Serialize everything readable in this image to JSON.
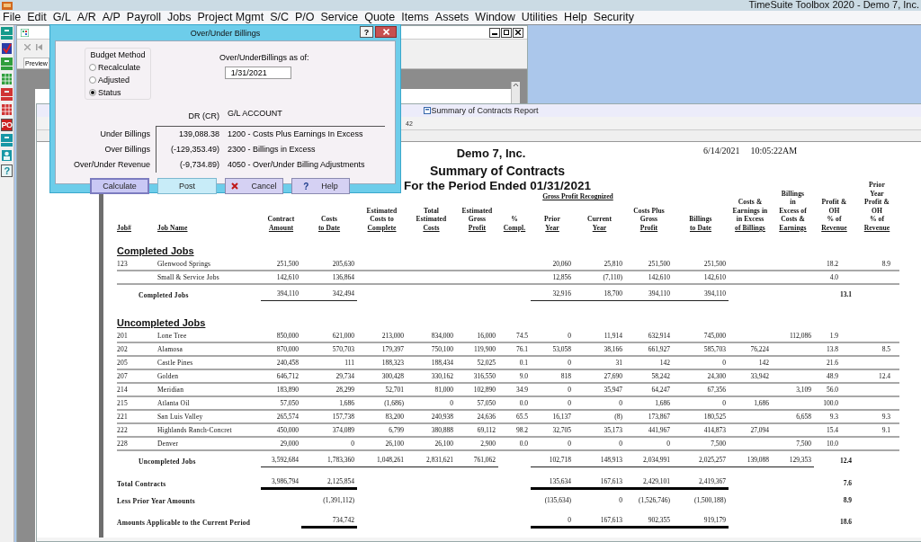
{
  "app": {
    "title": "TimeSuite Toolbox 2020 - Demo 7, Inc."
  },
  "menu": [
    "File",
    "Edit",
    "G/L",
    "A/R",
    "A/P",
    "Payroll",
    "Jobs",
    "Project Mgmt",
    "S/C",
    "P/O",
    "Service",
    "Quote",
    "Items",
    "Assets",
    "Window",
    "Utilities",
    "Help",
    "Security"
  ],
  "left_toolbar": [
    {
      "kind": "monitor",
      "color": "#169a8c"
    },
    {
      "kind": "check",
      "color": "#2a3ea8"
    },
    {
      "kind": "monitor",
      "color": "#2f9e3c"
    },
    {
      "kind": "grid",
      "color": "#2f9e3c"
    },
    {
      "kind": "monitor",
      "color": "#d03434"
    },
    {
      "kind": "grid",
      "color": "#d03434"
    },
    {
      "kind": "text",
      "label": "PO",
      "color": "#cc1f1f"
    },
    {
      "kind": "monitor",
      "color": "#1797a6"
    },
    {
      "kind": "person",
      "color": "#1797a6"
    },
    {
      "kind": "text",
      "label": "?",
      "color": "#1a8a9c"
    }
  ],
  "preview_window": {
    "tab": "Preview",
    "toolbar": [
      {
        "kind": "close",
        "disabled": true
      },
      {
        "kind": "first",
        "disabled": true
      }
    ]
  },
  "report_window": {
    "title": "Summary of Contracts Report",
    "page_field": "42",
    "report": {
      "company": "Demo 7, Inc.",
      "title": "Summary of Contracts",
      "period": "For the Period Ended 01/31/2021",
      "date": "6/14/2021",
      "time": "10:05:22AM",
      "group_header": "Gross Profit Recognized",
      "columns": [
        {
          "lines": [
            "Job#"
          ]
        },
        {
          "lines": [
            "Job Name"
          ]
        },
        {
          "lines": [
            "Contract",
            "Amount"
          ]
        },
        {
          "lines": [
            "Costs",
            "to Date"
          ]
        },
        {
          "lines": [
            "Estimated",
            "Costs to",
            "Complete"
          ]
        },
        {
          "lines": [
            "Total",
            "Estimated",
            "Costs"
          ]
        },
        {
          "lines": [
            "Estimated",
            "Gross",
            "Profit"
          ]
        },
        {
          "lines": [
            "%",
            "Compl."
          ]
        },
        {
          "lines": [
            "Prior",
            "Year"
          ]
        },
        {
          "lines": [
            "Current",
            "Year"
          ]
        },
        {
          "lines": [
            "Costs Plus",
            "Gross",
            "Profit"
          ]
        },
        {
          "lines": [
            "Billings",
            "to Date"
          ]
        },
        {
          "lines": [
            "Costs &",
            "Earnings in",
            "in Excess",
            "of Billings"
          ]
        },
        {
          "lines": [
            "Billings",
            "in",
            "Excess of",
            "Costs &",
            "Earnings"
          ]
        },
        {
          "lines": [
            "Profit &",
            "OH",
            "% of",
            "Revenue"
          ]
        },
        {
          "lines": [
            "Prior",
            "Year",
            "Profit &",
            "OH",
            "% of",
            "Revenue"
          ]
        }
      ],
      "sections": [
        {
          "heading": "Completed Jobs",
          "rows": [
            {
              "job": "123",
              "name": "Glenwood Springs",
              "cells": [
                "251,500",
                "205,630",
                null,
                null,
                null,
                null,
                "20,060",
                "25,810",
                "251,500",
                "251,500",
                null,
                null,
                "18.2",
                "8.9"
              ]
            },
            {
              "name": "Small & Service Jobs",
              "cells": [
                "142,610",
                "136,864",
                null,
                null,
                null,
                null,
                "12,856",
                "(7,110)",
                "142,610",
                "142,610",
                null,
                null,
                "4.0",
                null
              ]
            }
          ],
          "total": {
            "label": "Completed Jobs",
            "cells": [
              "394,110",
              "342,494",
              null,
              null,
              null,
              null,
              "32,916",
              "18,700",
              "394,110",
              "394,110",
              null,
              null,
              "13.1",
              null
            ]
          }
        },
        {
          "heading": "Uncompleted Jobs",
          "rows": [
            {
              "job": "201",
              "name": "Lone Tree",
              "cells": [
                "850,000",
                "621,000",
                "213,000",
                "834,000",
                "16,000",
                "74.5",
                "0",
                "11,914",
                "632,914",
                "745,000",
                null,
                "112,086",
                "1.9",
                null
              ]
            },
            {
              "job": "202",
              "name": "Alamosa",
              "cells": [
                "870,000",
                "570,703",
                "179,397",
                "750,100",
                "119,900",
                "76.1",
                "53,058",
                "38,166",
                "661,927",
                "585,703",
                "76,224",
                null,
                "13.8",
                "8.5"
              ]
            },
            {
              "job": "205",
              "name": "Castle Pines",
              "cells": [
                "240,458",
                "111",
                "188,323",
                "188,434",
                "52,025",
                "0.1",
                "0",
                "31",
                "142",
                "0",
                "142",
                null,
                "21.6",
                null
              ]
            },
            {
              "job": "207",
              "name": "Golden",
              "cells": [
                "646,712",
                "29,734",
                "300,428",
                "330,162",
                "316,550",
                "9.0",
                "818",
                "27,690",
                "58,242",
                "24,300",
                "33,942",
                null,
                "48.9",
                "12.4"
              ]
            },
            {
              "job": "214",
              "name": "Meridian",
              "cells": [
                "183,890",
                "28,299",
                "52,701",
                "81,000",
                "102,890",
                "34.9",
                "0",
                "35,947",
                "64,247",
                "67,356",
                null,
                "3,109",
                "56.0",
                null
              ]
            },
            {
              "job": "215",
              "name": "Atlanta Oil",
              "cells": [
                "57,050",
                "1,686",
                "(1,686)",
                "0",
                "57,050",
                "0.0",
                "0",
                "0",
                "1,686",
                "0",
                "1,686",
                null,
                "100.0",
                null
              ]
            },
            {
              "job": "221",
              "name": "San Luis Valley",
              "cells": [
                "265,574",
                "157,738",
                "83,200",
                "240,938",
                "24,636",
                "65.5",
                "16,137",
                "(8)",
                "173,867",
                "180,525",
                null,
                "6,658",
                "9.3",
                "9.3"
              ]
            },
            {
              "job": "222",
              "name": "Highlands Ranch-Concret",
              "cells": [
                "450,000",
                "374,089",
                "6,799",
                "380,888",
                "69,112",
                "98.2",
                "32,705",
                "35,173",
                "441,967",
                "414,873",
                "27,094",
                null,
                "15.4",
                "9.1"
              ]
            },
            {
              "job": "228",
              "name": "Denver",
              "cells": [
                "29,000",
                "0",
                "26,100",
                "26,100",
                "2,900",
                "0.0",
                "0",
                "0",
                "0",
                "7,500",
                null,
                "7,500",
                "10.0",
                null
              ]
            }
          ],
          "total": {
            "label": "Uncompleted Jobs",
            "cells": [
              "3,592,684",
              "1,783,360",
              "1,048,261",
              "2,831,621",
              "761,062",
              null,
              "102,718",
              "148,913",
              "2,034,991",
              "2,025,257",
              "139,088",
              "129,353",
              "12.4",
              null
            ]
          }
        }
      ],
      "summary": [
        {
          "label": "Total Contracts",
          "cells": [
            "3,986,794",
            "2,125,854",
            null,
            null,
            null,
            null,
            "135,634",
            "167,613",
            "2,429,101",
            "2,419,367",
            null,
            null,
            "7.6",
            null
          ]
        },
        {
          "label": "Less Prior Year Amounts",
          "cells": [
            null,
            "(1,391,112)",
            null,
            null,
            null,
            null,
            "(135,634)",
            "0",
            "(1,526,746)",
            "(1,500,188)",
            null,
            null,
            "8.9",
            null
          ]
        },
        {
          "label": "Amounts Applicable to the Current Period",
          "cells": [
            null,
            "734,742",
            null,
            null,
            null,
            null,
            "0",
            "167,613",
            "902,355",
            "919,179",
            null,
            null,
            "18.6",
            null
          ]
        }
      ]
    }
  },
  "dialog": {
    "title": "Over/Under Billings",
    "help": "?",
    "budget_method": {
      "label": "Budget Method",
      "options": [
        {
          "label": "Recalculate",
          "selected": false
        },
        {
          "label": "Adjusted",
          "selected": false
        },
        {
          "label": "Status",
          "selected": true
        }
      ]
    },
    "as_of": {
      "label": "Over/UnderBillings as of:",
      "value": "1/31/2021"
    },
    "headers": [
      "DR (CR)",
      "G/L ACCOUNT"
    ],
    "rows": [
      {
        "label": "Under Billings",
        "amount": "139,088.38",
        "account": "1200 - Costs Plus Earnings In Excess"
      },
      {
        "label": "Over Billings",
        "amount": "(-129,353.49)",
        "account": "2300 - Billings in Excess"
      },
      {
        "label": "Over/Under Revenue",
        "amount": "(-9,734.89)",
        "account": "4050 - Over/Under Billing Adjustments"
      }
    ],
    "buttons": [
      {
        "label": "Calculate",
        "kind": "default"
      },
      {
        "label": "Post",
        "kind": "light"
      },
      {
        "label": "Cancel",
        "kind": "plain",
        "icon": {
          "kind": "cross"
        }
      },
      {
        "label": "Help",
        "kind": "plain",
        "icon": {
          "kind": "glyph",
          "text": "?"
        }
      }
    ]
  }
}
